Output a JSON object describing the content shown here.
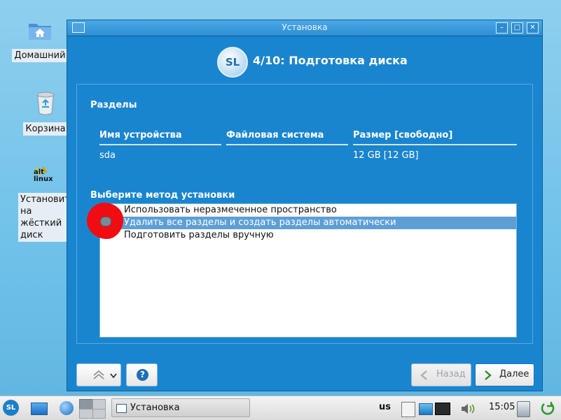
{
  "desktop": {
    "home_label": "Домашний",
    "trash_label": "Корзина",
    "installer_label": "Установит на жёсткий диск",
    "installer_logo_text": "alt linux"
  },
  "window": {
    "title": "Установка",
    "logo_text": "SL",
    "step_title": "4/10: Подготовка диска",
    "partitions": {
      "heading": "Разделы",
      "columns": [
        "Имя устройства",
        "Файловая система",
        "Размер [свободно]"
      ],
      "rows": [
        {
          "device": "sda",
          "filesystem": "",
          "size": "12 GB [12 GB]"
        }
      ]
    },
    "method": {
      "heading": "Выберите метод установки",
      "options": [
        "Использовать неразмеченное пространство",
        "Удалить все разделы и создать разделы автоматически",
        "Подготовить разделы вручную"
      ],
      "selected_index": 1
    },
    "buttons": {
      "back": "Назад",
      "next": "Далее"
    }
  },
  "taskbar": {
    "start_logo_text": "SL",
    "task_label": "Установка",
    "keyboard_layout": "us",
    "clock": "15:05"
  },
  "colors": {
    "window_bg": "#1a85cf",
    "desktop_bg": "#7ac6ec",
    "selection": "#5d9fd5",
    "annotation": "#f10b12"
  }
}
